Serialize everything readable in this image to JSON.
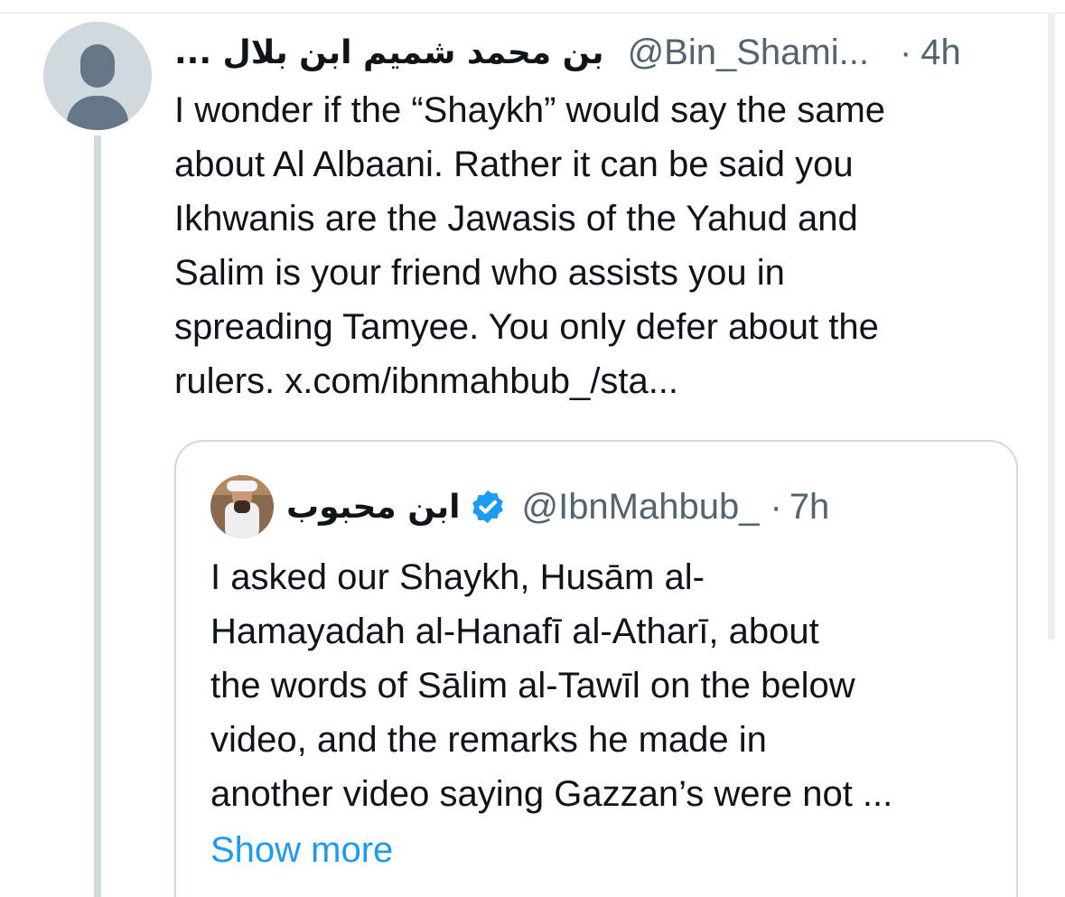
{
  "tweet": {
    "author_name": "بن محمد شميم ابن بلال ...",
    "handle": "@Bin_Shami...",
    "separator": "·",
    "time": "4h",
    "avatar_icon": "default-avatar-icon",
    "text": "I wonder if the “Shaykh” would say the same\nabout Al Albaani. Rather it can be said you\nIkhwanis are the Jawasis of the Yahud and\nSalim is your friend who assists you in\nspreading Tamyee. You only defer about the\nrulers. x.com/ibnmahbub_/sta..."
  },
  "quoted_tweet": {
    "author_name": "ابن محبوب",
    "verified_icon": "verified-badge-icon",
    "handle": "@IbnMahbub_",
    "separator": "·",
    "time": "7h",
    "text": "I asked our Shaykh, Husām al-\nHamayadah al-Hanafī al-Atharī, about\nthe words of Sālim al-Tawīl on the below\nvideo, and the remarks he made in\nanother video saying Gazzan’s were not ...",
    "show_more_label": "Show more"
  },
  "colors": {
    "text": "#0f1419",
    "secondary": "#536471",
    "link": "#1d9bf0",
    "border": "#cfd9de"
  }
}
